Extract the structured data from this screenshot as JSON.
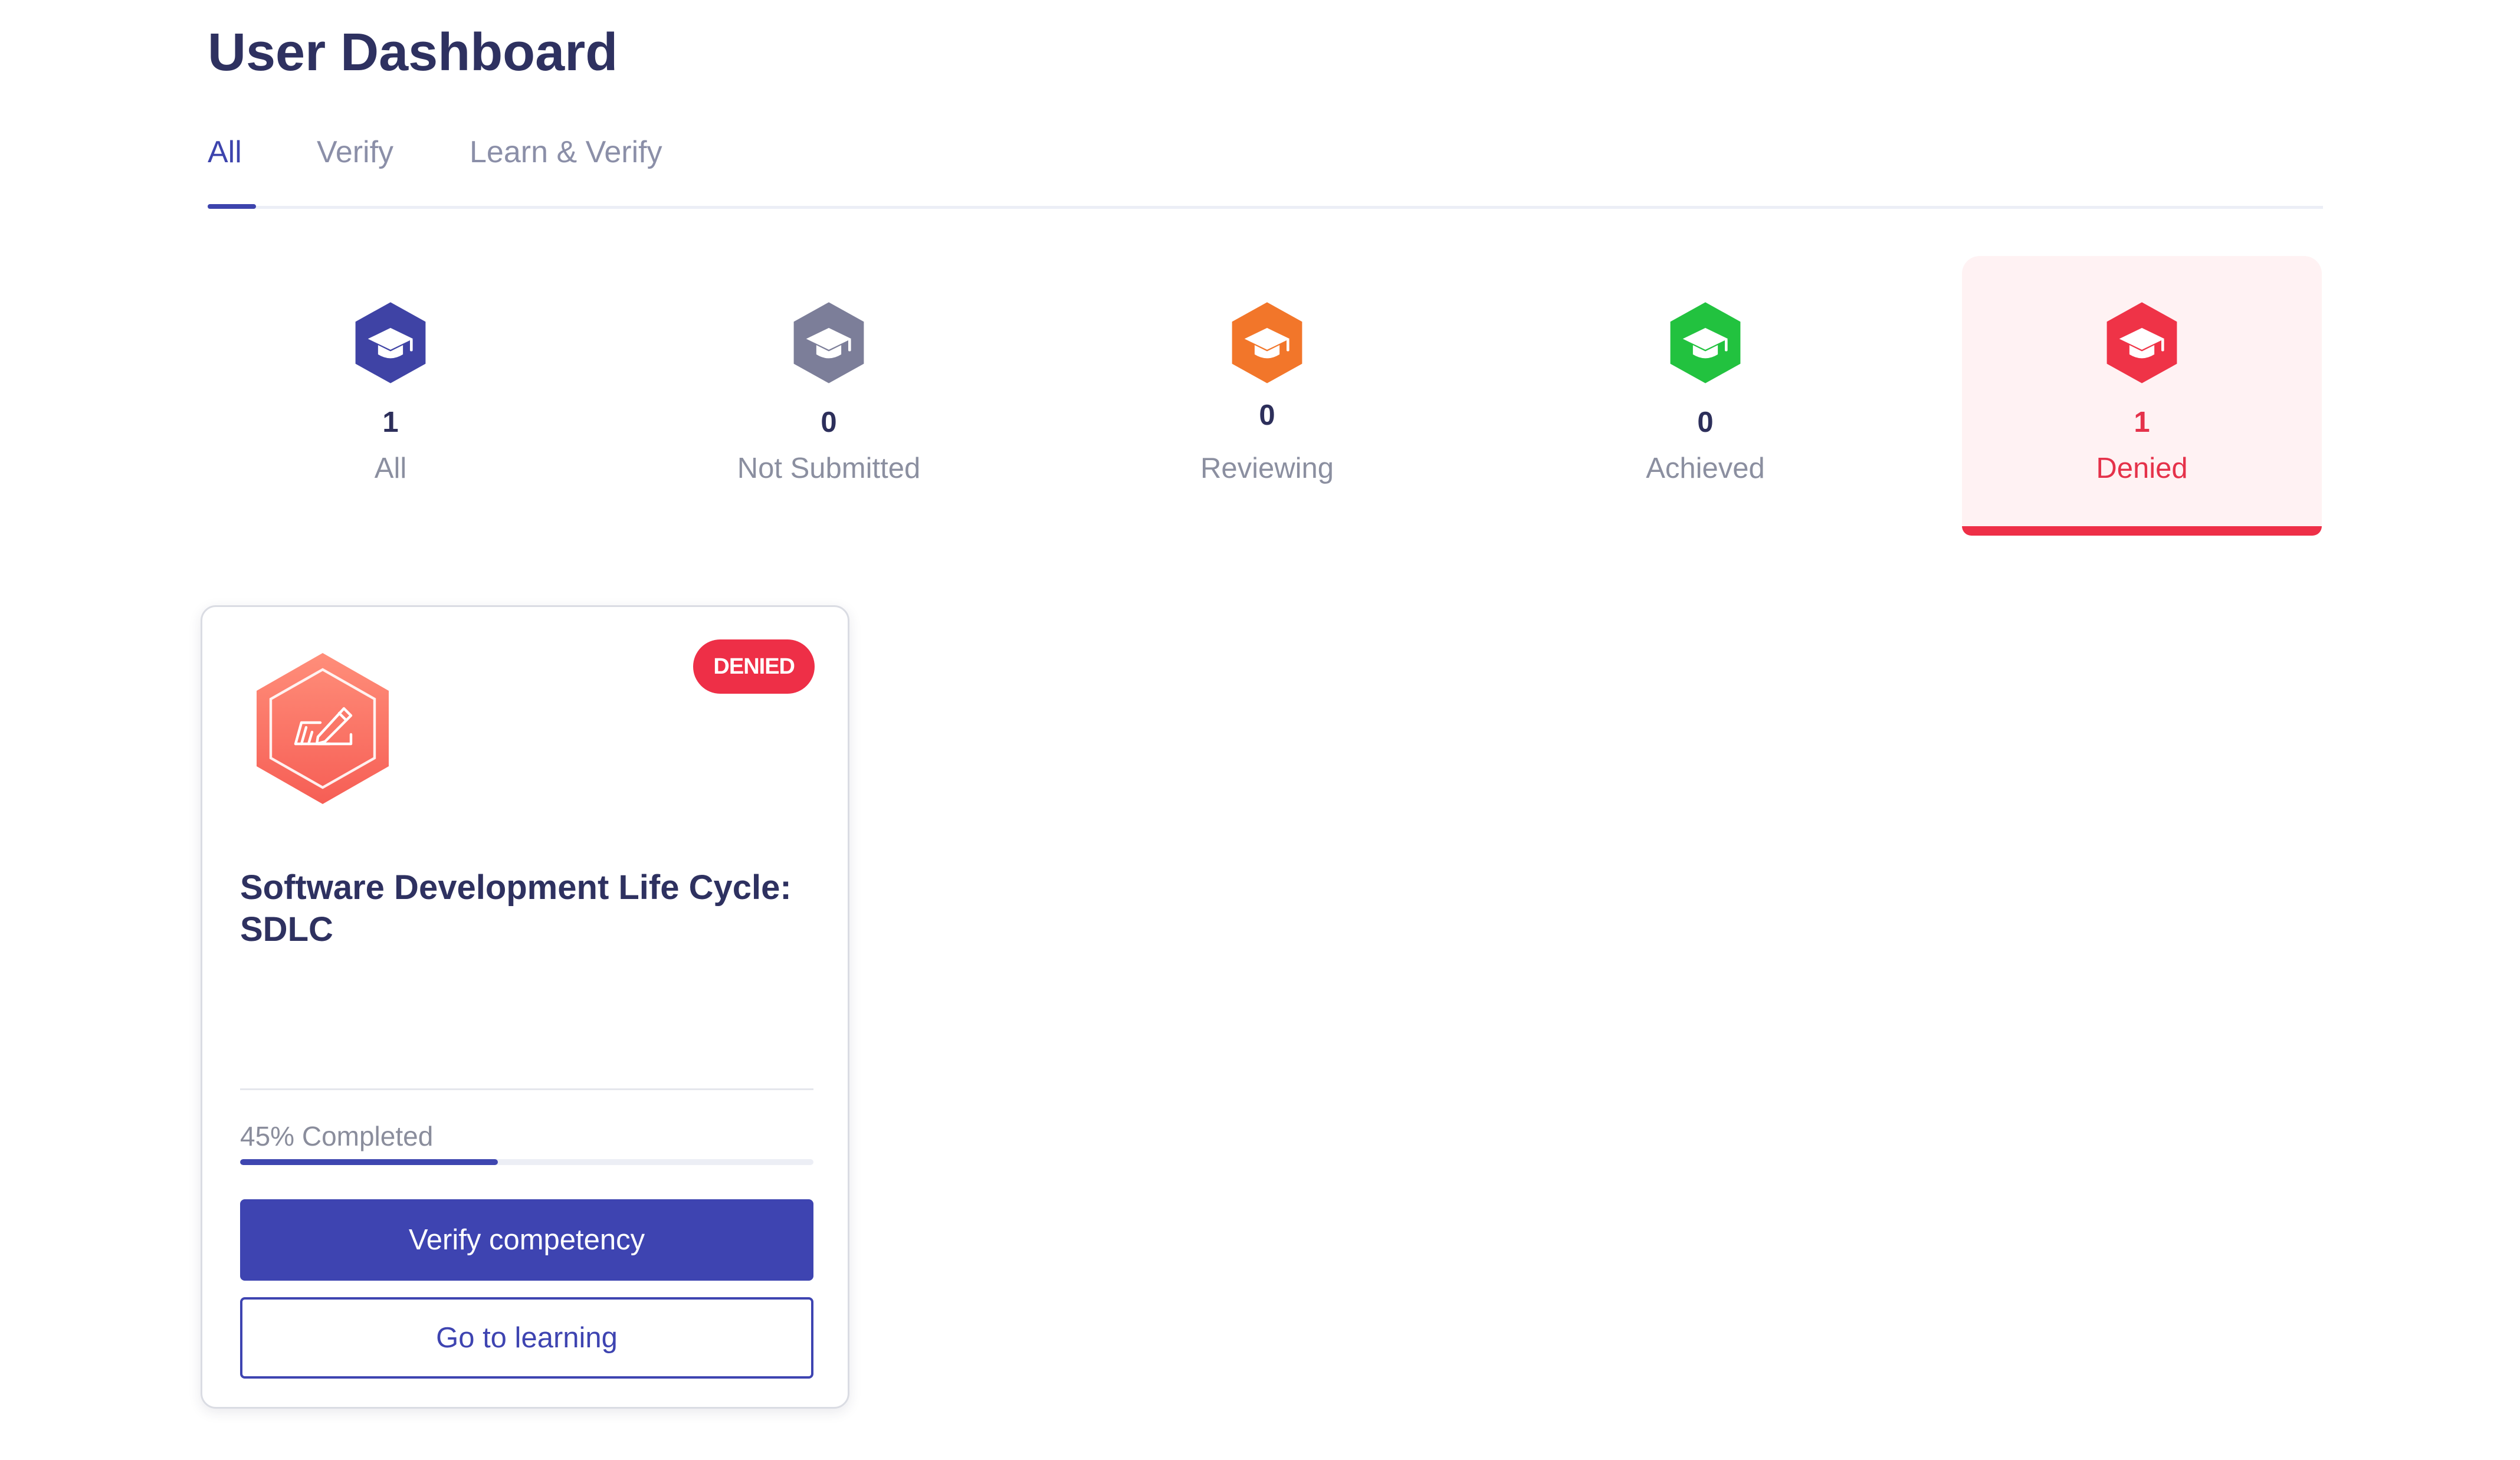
{
  "page": {
    "title": "User Dashboard"
  },
  "tabs": [
    {
      "label": "All",
      "active": true
    },
    {
      "label": "Verify",
      "active": false
    },
    {
      "label": "Learn & Verify",
      "active": false
    }
  ],
  "stats": [
    {
      "count": "1",
      "label": "All",
      "color": "#3f43a5",
      "icon": "graduation-cap-icon",
      "selected": false
    },
    {
      "count": "0",
      "label": "Not Submitted",
      "color": "#7c7e99",
      "icon": "graduation-cap-icon",
      "selected": false
    },
    {
      "count": "0",
      "label": "Reviewing",
      "color": "#f2762a",
      "icon": "graduation-cap-icon",
      "selected": false
    },
    {
      "count": "0",
      "label": "Achieved",
      "color": "#22c23f",
      "icon": "graduation-cap-icon",
      "selected": false
    },
    {
      "count": "1",
      "label": "Denied",
      "color": "#ef3347",
      "icon": "graduation-cap-icon",
      "selected": true
    }
  ],
  "card": {
    "badge": "DENIED",
    "title": "Software Development Life Cycle: SDLC",
    "icon": "pen-writing-icon",
    "progress_text": "45% Completed",
    "progress": 0.45,
    "primary_button": "Verify competency",
    "secondary_button": "Go to learning"
  },
  "colors": {
    "accent": "#3e44b1",
    "denied": "#ee2f47",
    "heading": "#2e3160",
    "muted": "#8b8fa8"
  }
}
